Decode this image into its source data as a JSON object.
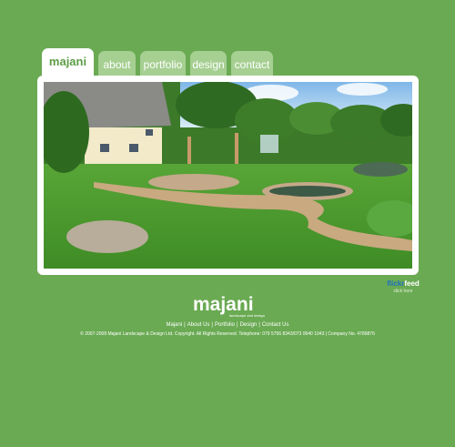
{
  "nav": {
    "tabs": [
      {
        "label": "majani"
      },
      {
        "label": "about"
      },
      {
        "label": "portfolio"
      },
      {
        "label": "design"
      },
      {
        "label": "contact"
      }
    ]
  },
  "photo": {
    "alt": "Garden with thatched cottage, lawn, gravel paths and pond"
  },
  "flickr": {
    "brand_a": "flickr",
    "brand_b": "feed",
    "link": "click here"
  },
  "logo": {
    "name": "majani",
    "tagline": "landscape and design"
  },
  "footer": {
    "links": [
      "Majani",
      "About Us",
      "Portfolio",
      "Design",
      "Contact Us"
    ],
    "copyright": "© 2007-2008 Majani Landscape & Design Ltd. Copyright. All Rights Reserved.  Telephone: 079 5756 8343/073 0640 1043 | Company No. 4789876"
  },
  "colors": {
    "background": "#6aaa53",
    "tab": "#a6cf92",
    "active_tab": "#ffffff",
    "accent": "#5e9d45"
  }
}
